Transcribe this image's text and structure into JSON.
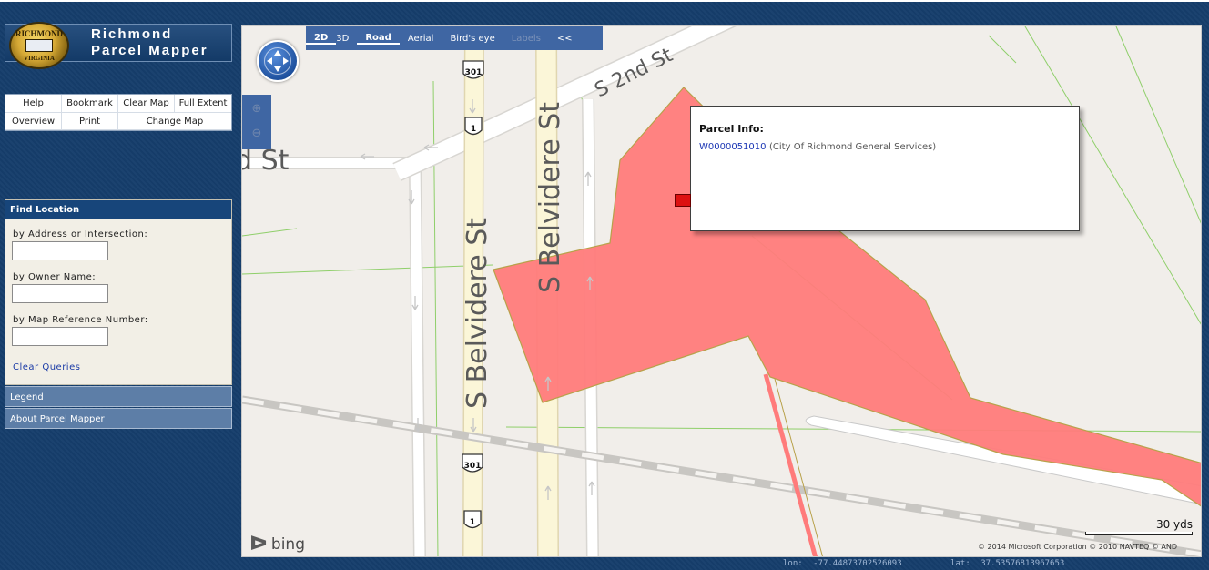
{
  "app": {
    "title_line1": "Richmond",
    "title_line2": "Parcel Mapper",
    "seal_top": "RICHMOND",
    "seal_bottom": "VIRGINIA"
  },
  "toolbar": {
    "help": "Help",
    "bookmark": "Bookmark",
    "clear_map": "Clear Map",
    "full_extent": "Full Extent",
    "overview": "Overview",
    "print": "Print",
    "change_map": "Change Map"
  },
  "find": {
    "title": "Find Location",
    "address_label": "by Address or Intersection:",
    "address_value": "",
    "owner_label": "by Owner Name:",
    "owner_value": "",
    "mapref_label": "by Map Reference Number:",
    "mapref_value": "",
    "clear_queries": "Clear Queries"
  },
  "legend": "Legend",
  "about": "About Parcel Mapper",
  "map_nav": {
    "mode_2d": "2D",
    "mode_3d": "3D",
    "road": "Road",
    "aerial": "Aerial",
    "birds_eye": "Bird's eye",
    "labels": "Labels",
    "collapse": "<<"
  },
  "map_labels": {
    "street_2nd": "S 2nd St",
    "street_belvidere": "S Belvidere St",
    "street_partial": "d St",
    "route_301": "301",
    "route_1": "1"
  },
  "popup": {
    "title": "Parcel Info:",
    "parcel_id": "W0000051010",
    "owner": "(City Of Richmond General Services)"
  },
  "map_footer": {
    "brand": "bing",
    "scale": "30 yds",
    "copyright": "© 2014 Microsoft Corporation   © 2010 NAVTEQ   © AND"
  },
  "coords": {
    "lon_label": "lon:",
    "lon_value": "-77.44873702526093",
    "lat_label": "lat:",
    "lat_value": "37.53576813967653"
  },
  "colors": {
    "parcel_fill": "#ff7b7b",
    "panel_header": "#17457a",
    "nav_bar": "#3f66a3"
  }
}
